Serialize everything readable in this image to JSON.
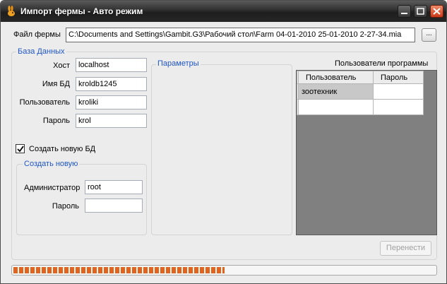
{
  "window": {
    "title": "Импорт фермы - Авто режим"
  },
  "file": {
    "label": "Файл фермы",
    "path": "C:\\Documents and Settings\\Gambit.G3\\Рабочий стол\\Farm 04-01-2010 25-01-2010 2-27-34.mia",
    "browse_label": "..."
  },
  "database": {
    "title": "База Данных",
    "host_label": "Хост",
    "host": "localhost",
    "dbname_label": "Имя БД",
    "dbname": "kroldb1245",
    "user_label": "Пользователь",
    "user": "kroliki",
    "password_label": "Пароль",
    "password": "krol"
  },
  "create_db": {
    "checkbox_label": "Создать новую БД",
    "checked": true,
    "group_title": "Создать новую",
    "admin_label": "Администратор",
    "admin": "root",
    "admin_password_label": "Пароль",
    "admin_password": ""
  },
  "params": {
    "title": "Параметры"
  },
  "users": {
    "title": "Пользователи программы",
    "columns": [
      "Пользователь",
      "Пароль"
    ],
    "rows": [
      [
        "зоотехник",
        ""
      ],
      [
        "",
        ""
      ]
    ]
  },
  "actions": {
    "transfer_label": "Перенести"
  },
  "progress": {
    "fraction": 0.5
  },
  "colors": {
    "accent": "#1f56c4",
    "progress": "#e0641e"
  }
}
